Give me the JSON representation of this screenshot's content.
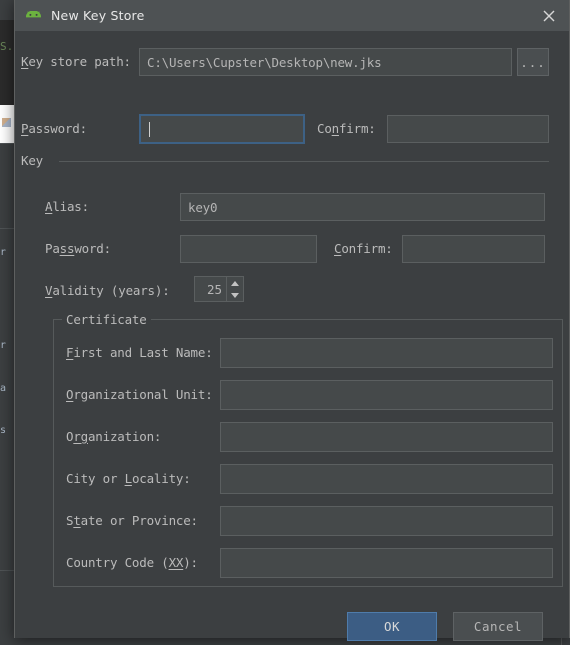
{
  "background": {
    "editor_token": "S.",
    "side_texts": [
      "r",
      "r",
      "a",
      "s"
    ]
  },
  "dialog": {
    "title": "New Key Store",
    "app_icon": "android-robot-icon",
    "close_icon": "close-icon",
    "keystore": {
      "label_pre": "",
      "label_mnemonic": "K",
      "label_post": "ey store path:",
      "value": "C:\\Users\\Cupster\\Desktop\\new.jks",
      "browse_label": "..."
    },
    "store_password": {
      "label_pre": "",
      "label_mnemonic": "P",
      "label_post": "assword:",
      "value": "",
      "focused": true
    },
    "store_confirm": {
      "label_pre": "Co",
      "label_mnemonic": "n",
      "label_post": "firm:",
      "value": ""
    },
    "key_group": {
      "title": "Key",
      "alias": {
        "label_pre": "",
        "label_mnemonic": "A",
        "label_post": "lias:",
        "value": "key0"
      },
      "password": {
        "label_pre": "Pa",
        "label_mnemonic": "ss",
        "label_post": "word:",
        "value": ""
      },
      "confirm": {
        "label_pre": "",
        "label_mnemonic": "C",
        "label_post": "onfirm:",
        "value": ""
      },
      "validity": {
        "label_pre": "",
        "label_mnemonic": "V",
        "label_post": "alidity (years):",
        "value": "25"
      }
    },
    "certificate_group": {
      "title": "Certificate",
      "rows": [
        {
          "label_pre": "",
          "label_mnemonic": "F",
          "label_post": "irst and Last Name:",
          "value": ""
        },
        {
          "label_pre": "",
          "label_mnemonic": "O",
          "label_post": "rganizational Unit:",
          "value": ""
        },
        {
          "label_pre": "O",
          "label_mnemonic": "rg",
          "label_post": "anization:",
          "value": ""
        },
        {
          "label_pre": "City or ",
          "label_mnemonic": "L",
          "label_post": "ocality:",
          "value": ""
        },
        {
          "label_pre": "S",
          "label_mnemonic": "t",
          "label_post": "ate or Province:",
          "value": ""
        },
        {
          "label_pre": "Country Code (",
          "label_mnemonic": "XX",
          "label_post": "):",
          "value": ""
        }
      ]
    },
    "buttons": {
      "ok": "OK",
      "cancel": "Cancel"
    }
  },
  "colors": {
    "dialog_bg": "#3c3f41",
    "titlebar_bg": "#4e5254",
    "field_bg": "#45494a",
    "field_border": "#5b5f60",
    "focus_border": "#3d6185",
    "default_button": "#3c5d84",
    "text": "#bbbbbb",
    "android_green": "#6cb33f"
  }
}
